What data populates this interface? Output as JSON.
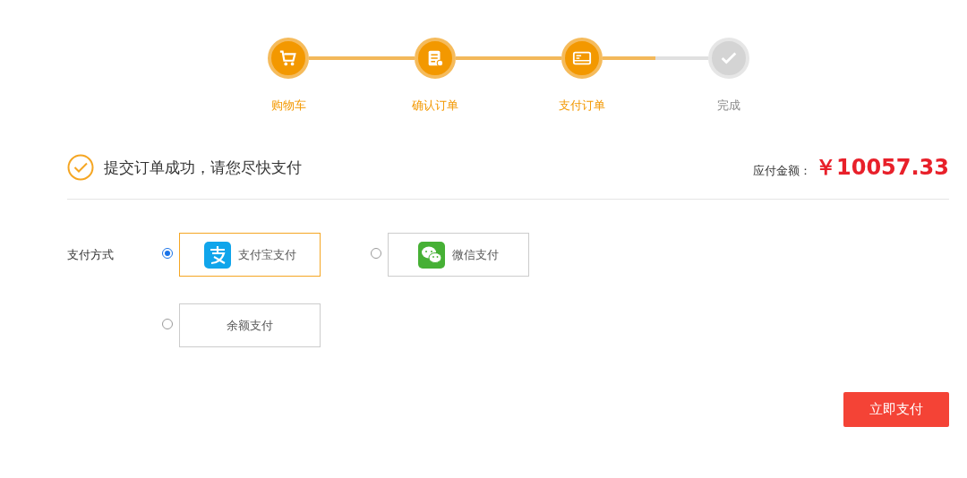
{
  "steps": [
    {
      "label": "购物车",
      "kind": "cart",
      "done": true
    },
    {
      "label": "确认订单",
      "kind": "confirm",
      "done": true
    },
    {
      "label": "支付订单",
      "kind": "pay",
      "done": true
    },
    {
      "label": "完成",
      "kind": "finish",
      "done": false
    }
  ],
  "connectors": [
    {
      "level": 1
    },
    {
      "level": 1
    },
    {
      "level": 0.5
    }
  ],
  "notice": "提交订单成功，请您尽快支付",
  "amount": {
    "label": "应付金额：",
    "value": "￥10057.33"
  },
  "payment": {
    "label": "支付方式",
    "methods": [
      {
        "kind": "alipay",
        "label": "支付宝支付",
        "selected": true
      },
      {
        "kind": "wechat",
        "label": "微信支付",
        "selected": false
      },
      {
        "kind": "balance",
        "label": "余额支付",
        "selected": false
      }
    ]
  },
  "submit": "立即支付"
}
